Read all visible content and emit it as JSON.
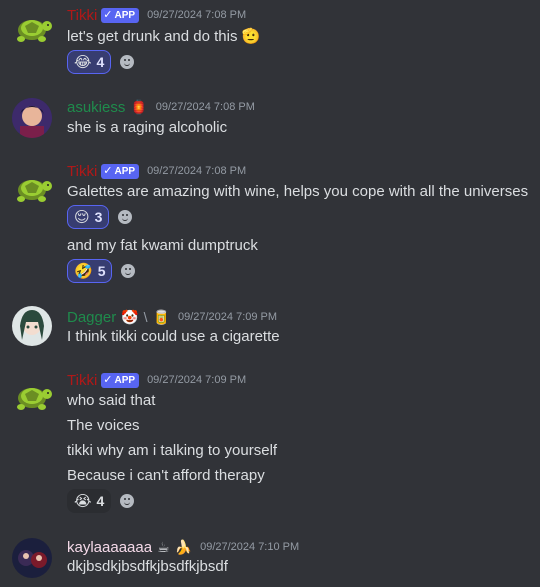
{
  "colors": {
    "tikki": "#b01818",
    "asukiess": "#1f8b4c",
    "dagger": "#1f8b4c",
    "kayla": "#f4d9e8"
  },
  "messages": [
    {
      "author": "Tikki",
      "badge": "APP",
      "timestamp": "09/27/2024 7:08 PM",
      "lines": [
        "let's get drunk and do this 🫡"
      ],
      "reactions": [
        {
          "emoji": "😂",
          "count": "4"
        }
      ]
    },
    {
      "author": "asukiess",
      "role_icon": "🏮",
      "timestamp": "09/27/2024 7:08 PM",
      "lines": [
        "she is a raging alcoholic"
      ]
    },
    {
      "author": "Tikki",
      "badge": "APP",
      "timestamp": "09/27/2024 7:08 PM",
      "lines": [
        "Galettes are amazing with wine, helps you cope with all the universes"
      ],
      "reactions": [
        {
          "emoji": "😌",
          "count": "3"
        }
      ],
      "lines2": [
        "and my fat kwami dumptruck"
      ],
      "reactions2": [
        {
          "emoji": "🤣",
          "count": "5"
        }
      ]
    },
    {
      "author": "Dagger",
      "role_icons": [
        "🤡",
        "\\",
        "🥫"
      ],
      "timestamp": "09/27/2024 7:09 PM",
      "lines": [
        "I think tikki could use a cigarette"
      ]
    },
    {
      "author": "Tikki",
      "badge": "APP",
      "timestamp": "09/27/2024 7:09 PM",
      "lines": [
        "who said that",
        "The voices",
        "tikki why am i talking to yourself",
        "Because i can't afford therapy"
      ],
      "reactions": [
        {
          "emoji": "😭",
          "count": "4"
        }
      ]
    },
    {
      "author": "kaylaaaaaaa",
      "role_icons": [
        "☕",
        "🍌"
      ],
      "timestamp": "09/27/2024 7:10 PM",
      "lines": [
        "dkjbsdkjbsdfkjbsdfkjbsdf"
      ]
    }
  ]
}
